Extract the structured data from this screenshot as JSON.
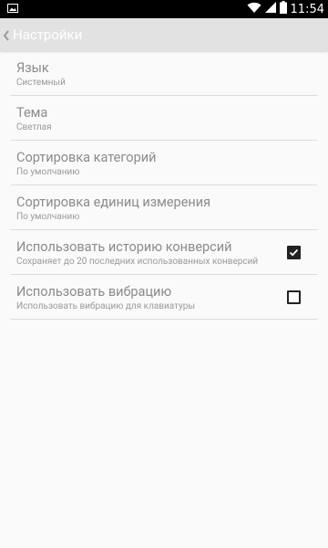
{
  "status_bar": {
    "time": "11:54",
    "icons": [
      "image-notification-icon",
      "wifi-icon",
      "signal-icon",
      "battery-icon"
    ]
  },
  "app_bar": {
    "back_icon": "chevron-left-icon",
    "title": "Настройки"
  },
  "settings": [
    {
      "title": "Язык",
      "summary": "Системный"
    },
    {
      "title": "Тема",
      "summary": "Светлая"
    },
    {
      "title": "Сортировка категорий",
      "summary": "По умолчанию"
    },
    {
      "title": "Сортировка единиц измерения",
      "summary": "По умолчанию"
    },
    {
      "title": "Использовать историю конверсий",
      "summary": "Сохраняет до 20 последних использованных конверсий",
      "checked": true
    },
    {
      "title": "Использовать вибрацию",
      "summary": "Использовать вибрацию для клавиатуры",
      "checked": false
    }
  ],
  "colors": {
    "status_bar_bg": "#000000",
    "app_bar_bg": "#e2e2e2",
    "title_text": "#ffffff",
    "item_title": "#8b8b8b",
    "item_summary": "#9a9a9a",
    "divider": "#dcdcdc",
    "background": "#fafafa"
  }
}
